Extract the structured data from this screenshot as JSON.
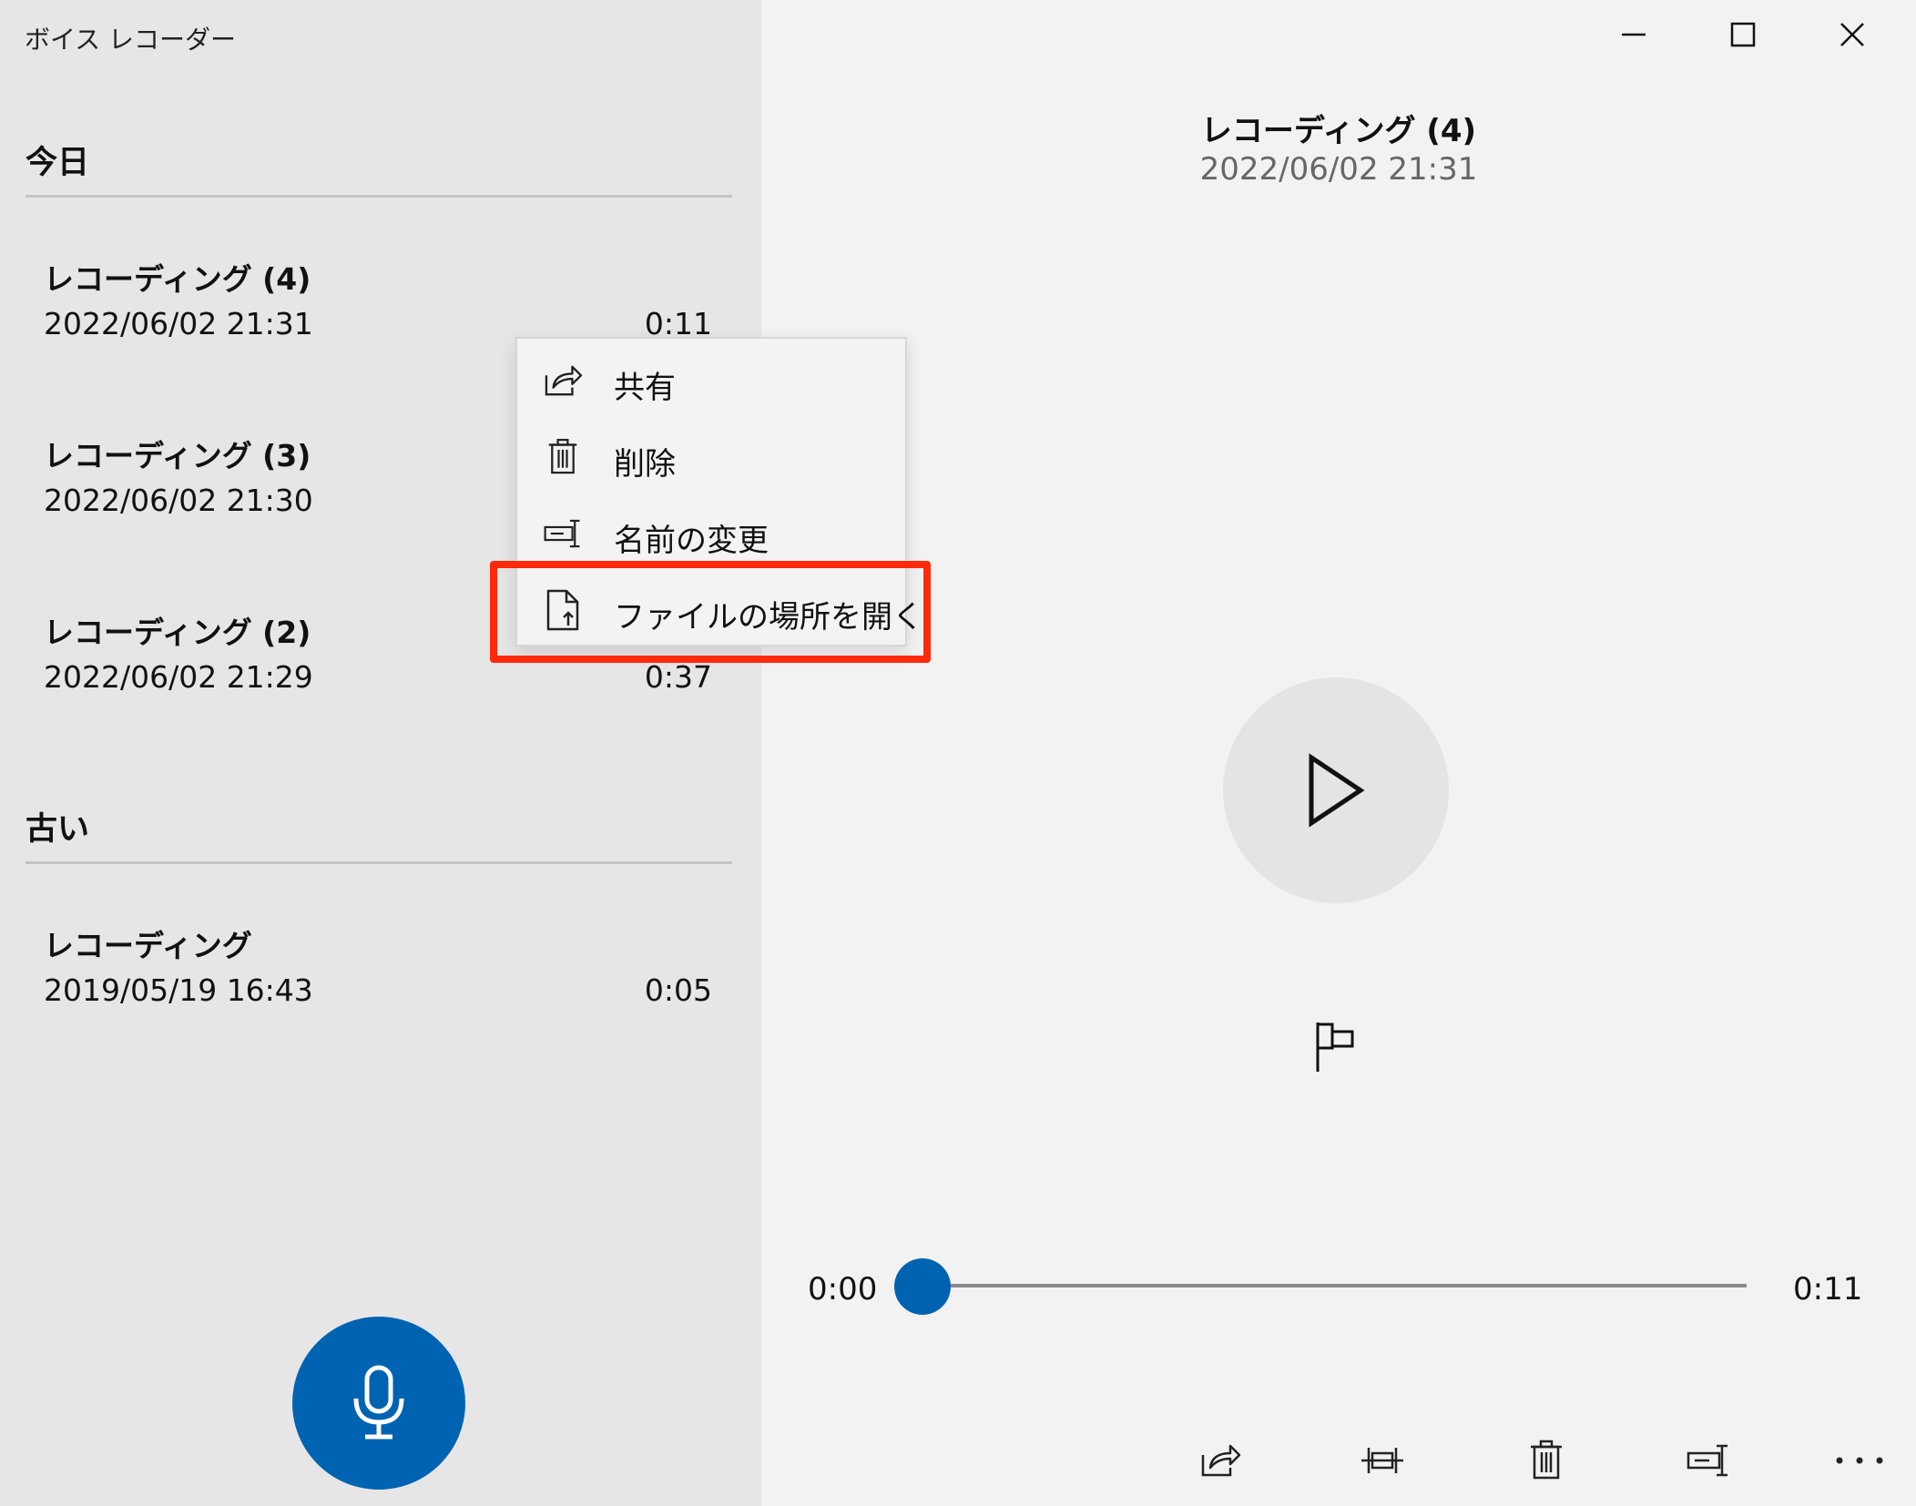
{
  "app": {
    "title": "ボイス レコーダー"
  },
  "sidebar": {
    "sections": [
      {
        "title": "今日",
        "items": [
          {
            "name": "レコーディング (4)",
            "date": "2022/06/02 21:31",
            "duration": "0:11"
          },
          {
            "name": "レコーディング (3)",
            "date": "2022/06/02 21:30",
            "duration": ""
          },
          {
            "name": "レコーディング (2)",
            "date": "2022/06/02 21:29",
            "duration": "0:37"
          }
        ]
      },
      {
        "title": "古い",
        "items": [
          {
            "name": "レコーディング",
            "date": "2019/05/19 16:43",
            "duration": "0:05"
          }
        ]
      }
    ],
    "record_button_icon": "microphone-icon"
  },
  "context_menu": {
    "items": [
      {
        "label": "共有",
        "icon": "share-icon"
      },
      {
        "label": "削除",
        "icon": "trash-icon"
      },
      {
        "label": "名前の変更",
        "icon": "rename-icon"
      },
      {
        "label": "ファイルの場所を開く",
        "icon": "open-file-location-icon",
        "highlighted": true
      }
    ],
    "highlight_color": "#ff2a0c"
  },
  "detail": {
    "title": "レコーディング (4)",
    "date": "2022/06/02 21:31",
    "current_time": "0:00",
    "total_time": "0:11",
    "progress": 0,
    "toolbar_icons": [
      "share-icon",
      "trim-icon",
      "trash-icon",
      "rename-icon",
      "more-icon"
    ]
  },
  "window_controls": [
    "minimize-icon",
    "maximize-icon",
    "close-icon"
  ],
  "colors": {
    "accent": "#0063b1",
    "sidebar_bg": "#e6e6e6",
    "main_bg": "#f2f2f2"
  }
}
